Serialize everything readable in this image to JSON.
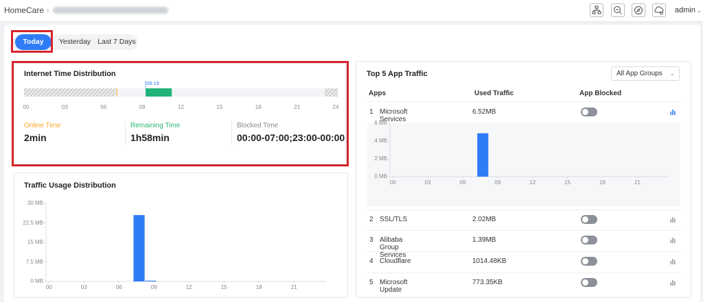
{
  "header": {
    "breadcrumb_root": "HomeCare",
    "breadcrumb_sep": "›",
    "user": "admin",
    "user_caret": "⌄"
  },
  "tabs": [
    {
      "label": "Today",
      "active": true
    },
    {
      "label": "Yesterday",
      "active": false
    },
    {
      "label": "Last 7 Days",
      "active": false
    }
  ],
  "internet_time": {
    "title": "Internet Time Distribution",
    "current_marker": "09:19",
    "axis_ticks": [
      "00",
      "03",
      "06",
      "09",
      "12",
      "15",
      "18",
      "21",
      "24"
    ],
    "blocked_ranges_hours": [
      [
        0,
        7
      ],
      [
        23,
        24
      ]
    ],
    "online_range_hours": [
      9.3,
      11.3
    ],
    "stats": [
      {
        "label": "Online Time",
        "value": "2min",
        "color": "#f5a623"
      },
      {
        "label": "Remaining Time",
        "value": "1h58min",
        "color": "#2bb673"
      },
      {
        "label": "Blocked Time",
        "value": "00:00-07:00;23:00-00:00",
        "color": "#888888"
      }
    ]
  },
  "traffic_usage": {
    "title": "Traffic Usage Distribution",
    "chart_data": {
      "type": "bar",
      "y_ticks": [
        "30 MB",
        "22.5 MB",
        "15 MB",
        "7.5 MB",
        "0 MB"
      ],
      "x_ticks": [
        "00",
        "03",
        "06",
        "09",
        "12",
        "15",
        "18",
        "21"
      ],
      "ylim": [
        0,
        30
      ],
      "x_hours": [
        7.5,
        8.5
      ],
      "values": [
        25.5,
        0.3
      ]
    }
  },
  "top_apps": {
    "title": "Top 5 App Traffic",
    "filter_label": "All App Groups",
    "filter_chevron": "⌄",
    "columns": [
      "Apps",
      "Used Traffic",
      "App Blocked"
    ],
    "rows": [
      {
        "num": "1",
        "name": "Microsoft Services",
        "traffic": "6.52MB"
      },
      {
        "num": "2",
        "name": "SSL/TLS",
        "traffic": "2.02MB"
      },
      {
        "num": "3",
        "name": "Alibaba Group Services",
        "traffic": "1.39MB"
      },
      {
        "num": "4",
        "name": "Cloudflare",
        "traffic": "1014.48KB"
      },
      {
        "num": "5",
        "name": "Microsoft Update",
        "traffic": "773.35KB"
      }
    ],
    "chart_data": {
      "type": "bar",
      "y_ticks": [
        "6 MB",
        "4 MB",
        "2 MB",
        "0 MB"
      ],
      "x_ticks": [
        "00",
        "03",
        "06",
        "09",
        "12",
        "15",
        "18",
        "21"
      ],
      "ylim": [
        0,
        8
      ],
      "x_hours": [
        7.5
      ],
      "values": [
        6.5
      ]
    }
  },
  "colors": {
    "accent": "#2f7cf6",
    "online": "#21b37a",
    "highlight": "#d5232b"
  }
}
